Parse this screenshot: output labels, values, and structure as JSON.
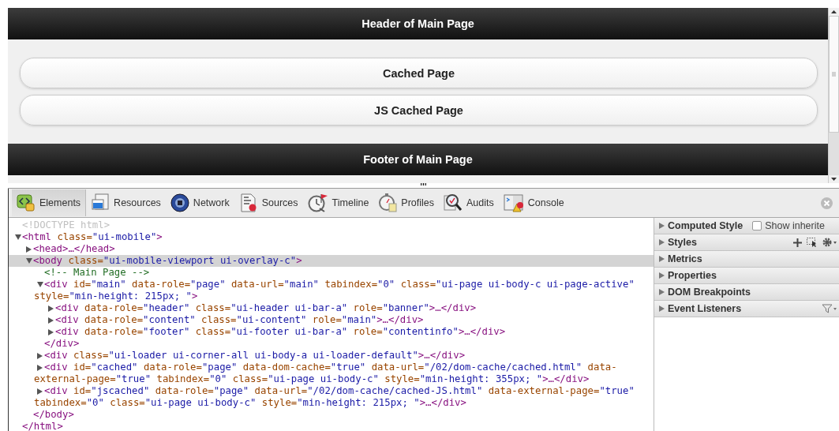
{
  "page": {
    "header": "Header of Main Page",
    "buttons": [
      "Cached Page",
      "JS Cached Page"
    ],
    "footer": "Footer of Main Page"
  },
  "devtools": {
    "tabs": [
      {
        "label": "Elements",
        "selected": true
      },
      {
        "label": "Resources",
        "selected": false
      },
      {
        "label": "Network",
        "selected": false
      },
      {
        "label": "Sources",
        "selected": false
      },
      {
        "label": "Timeline",
        "selected": false
      },
      {
        "label": "Profiles",
        "selected": false
      },
      {
        "label": "Audits",
        "selected": false
      },
      {
        "label": "Console",
        "selected": false
      }
    ],
    "dom_tree": [
      {
        "selected": false,
        "lines": [
          [
            {
              "kind": "doctype",
              "text": "<!DOCTYPE html>"
            }
          ]
        ]
      },
      {
        "selected": false,
        "expanded": true,
        "lines": [
          [
            {
              "kind": "tag",
              "text": "<html"
            },
            {
              "kind": "attr",
              "text": " class="
            },
            {
              "kind": "value",
              "text": "\"ui-mobile\""
            },
            {
              "kind": "tag",
              "text": ">"
            }
          ]
        ],
        "closing": "</html>",
        "children": [
          {
            "selected": false,
            "expanded": false,
            "lines": [
              [
                {
                  "kind": "tag",
                  "text": "<head>…</head>"
                }
              ]
            ]
          },
          {
            "selected": true,
            "expanded": true,
            "lines": [
              [
                {
                  "kind": "tag",
                  "text": "<body"
                },
                {
                  "kind": "attr",
                  "text": " class="
                },
                {
                  "kind": "value",
                  "text": "\"ui-mobile-viewport ui-overlay-c\""
                },
                {
                  "kind": "tag",
                  "text": ">"
                }
              ]
            ],
            "closing": "</body>",
            "children": [
              {
                "selected": false,
                "lines": [
                  [
                    {
                      "kind": "comment",
                      "text": "<!-- Main Page -->"
                    }
                  ]
                ]
              },
              {
                "selected": false,
                "expanded": true,
                "lines": [
                  [
                    {
                      "kind": "tag",
                      "text": "<div"
                    },
                    {
                      "kind": "attr",
                      "text": " id="
                    },
                    {
                      "kind": "value",
                      "text": "\"main\""
                    },
                    {
                      "kind": "attr",
                      "text": " data-role="
                    },
                    {
                      "kind": "value",
                      "text": "\"page\""
                    },
                    {
                      "kind": "attr",
                      "text": " data-url="
                    },
                    {
                      "kind": "value",
                      "text": "\"main\""
                    },
                    {
                      "kind": "attr",
                      "text": " tabindex="
                    },
                    {
                      "kind": "value",
                      "text": "\"0\""
                    },
                    {
                      "kind": "attr",
                      "text": " class="
                    },
                    {
                      "kind": "value",
                      "text": "\"ui-page ui-body-c ui-page-active\""
                    }
                  ],
                  [
                    {
                      "kind": "attr",
                      "text": "style="
                    },
                    {
                      "kind": "value",
                      "text": "\"min-height: 215px; \""
                    },
                    {
                      "kind": "tag",
                      "text": ">"
                    }
                  ]
                ],
                "closing": "</div>",
                "children": [
                  {
                    "selected": false,
                    "expanded": false,
                    "lines": [
                      [
                        {
                          "kind": "tag",
                          "text": "<div"
                        },
                        {
                          "kind": "attr",
                          "text": " data-role="
                        },
                        {
                          "kind": "value",
                          "text": "\"header\""
                        },
                        {
                          "kind": "attr",
                          "text": " class="
                        },
                        {
                          "kind": "value",
                          "text": "\"ui-header ui-bar-a\""
                        },
                        {
                          "kind": "attr",
                          "text": " role="
                        },
                        {
                          "kind": "value",
                          "text": "\"banner\""
                        },
                        {
                          "kind": "tag",
                          "text": ">…</div>"
                        }
                      ]
                    ]
                  },
                  {
                    "selected": false,
                    "expanded": false,
                    "lines": [
                      [
                        {
                          "kind": "tag",
                          "text": "<div"
                        },
                        {
                          "kind": "attr",
                          "text": " data-role="
                        },
                        {
                          "kind": "value",
                          "text": "\"content\""
                        },
                        {
                          "kind": "attr",
                          "text": " class="
                        },
                        {
                          "kind": "value",
                          "text": "\"ui-content\""
                        },
                        {
                          "kind": "attr",
                          "text": " role="
                        },
                        {
                          "kind": "value",
                          "text": "\"main\""
                        },
                        {
                          "kind": "tag",
                          "text": ">…</div>"
                        }
                      ]
                    ]
                  },
                  {
                    "selected": false,
                    "expanded": false,
                    "lines": [
                      [
                        {
                          "kind": "tag",
                          "text": "<div"
                        },
                        {
                          "kind": "attr",
                          "text": " data-role="
                        },
                        {
                          "kind": "value",
                          "text": "\"footer\""
                        },
                        {
                          "kind": "attr",
                          "text": " class="
                        },
                        {
                          "kind": "value",
                          "text": "\"ui-footer ui-bar-a\""
                        },
                        {
                          "kind": "attr",
                          "text": " role="
                        },
                        {
                          "kind": "value",
                          "text": "\"contentinfo\""
                        },
                        {
                          "kind": "tag",
                          "text": ">…</div>"
                        }
                      ]
                    ]
                  }
                ]
              },
              {
                "selected": false,
                "expanded": false,
                "lines": [
                  [
                    {
                      "kind": "tag",
                      "text": "<div"
                    },
                    {
                      "kind": "attr",
                      "text": " class="
                    },
                    {
                      "kind": "value",
                      "text": "\"ui-loader ui-corner-all ui-body-a ui-loader-default\""
                    },
                    {
                      "kind": "tag",
                      "text": ">…</div>"
                    }
                  ]
                ]
              },
              {
                "selected": false,
                "expanded": false,
                "lines": [
                  [
                    {
                      "kind": "tag",
                      "text": "<div"
                    },
                    {
                      "kind": "attr",
                      "text": " id="
                    },
                    {
                      "kind": "value",
                      "text": "\"cached\""
                    },
                    {
                      "kind": "attr",
                      "text": " data-role="
                    },
                    {
                      "kind": "value",
                      "text": "\"page\""
                    },
                    {
                      "kind": "attr",
                      "text": " data-dom-cache="
                    },
                    {
                      "kind": "value",
                      "text": "\"true\""
                    },
                    {
                      "kind": "attr",
                      "text": " data-url="
                    },
                    {
                      "kind": "value",
                      "text": "\"/02/dom-cache/cached.html\""
                    },
                    {
                      "kind": "attr",
                      "text": " data-"
                    }
                  ],
                  [
                    {
                      "kind": "attr",
                      "text": "external-page="
                    },
                    {
                      "kind": "value",
                      "text": "\"true\""
                    },
                    {
                      "kind": "attr",
                      "text": " tabindex="
                    },
                    {
                      "kind": "value",
                      "text": "\"0\""
                    },
                    {
                      "kind": "attr",
                      "text": " class="
                    },
                    {
                      "kind": "value",
                      "text": "\"ui-page ui-body-c\""
                    },
                    {
                      "kind": "attr",
                      "text": " style="
                    },
                    {
                      "kind": "value",
                      "text": "\"min-height: 355px; \""
                    },
                    {
                      "kind": "tag",
                      "text": ">…</div>"
                    }
                  ]
                ]
              },
              {
                "selected": false,
                "expanded": false,
                "lines": [
                  [
                    {
                      "kind": "tag",
                      "text": "<div"
                    },
                    {
                      "kind": "attr",
                      "text": " id="
                    },
                    {
                      "kind": "value",
                      "text": "\"jscached\""
                    },
                    {
                      "kind": "attr",
                      "text": " data-role="
                    },
                    {
                      "kind": "value",
                      "text": "\"page\""
                    },
                    {
                      "kind": "attr",
                      "text": " data-url="
                    },
                    {
                      "kind": "value",
                      "text": "\"/02/dom-cache/cached-JS.html\""
                    },
                    {
                      "kind": "attr",
                      "text": " data-external-page="
                    },
                    {
                      "kind": "value",
                      "text": "\"true\""
                    }
                  ],
                  [
                    {
                      "kind": "attr",
                      "text": "tabindex="
                    },
                    {
                      "kind": "value",
                      "text": "\"0\""
                    },
                    {
                      "kind": "attr",
                      "text": " class="
                    },
                    {
                      "kind": "value",
                      "text": "\"ui-page ui-body-c\""
                    },
                    {
                      "kind": "attr",
                      "text": " style="
                    },
                    {
                      "kind": "value",
                      "text": "\"min-height: 215px; \""
                    },
                    {
                      "kind": "tag",
                      "text": ">…</div>"
                    }
                  ]
                ]
              }
            ]
          }
        ]
      }
    ],
    "sidebar": [
      {
        "label": "Computed Style",
        "expanded": false,
        "kind": "checkbox",
        "checkbox": {
          "label": "Show inherite",
          "checked": false
        }
      },
      {
        "label": "Styles",
        "expanded": false,
        "kind": "styles"
      },
      {
        "label": "Metrics",
        "expanded": false,
        "kind": "plain"
      },
      {
        "label": "Properties",
        "expanded": false,
        "kind": "plain"
      },
      {
        "label": "DOM Breakpoints",
        "expanded": false,
        "kind": "plain"
      },
      {
        "label": "Event Listeners",
        "expanded": false,
        "kind": "filter"
      }
    ]
  }
}
